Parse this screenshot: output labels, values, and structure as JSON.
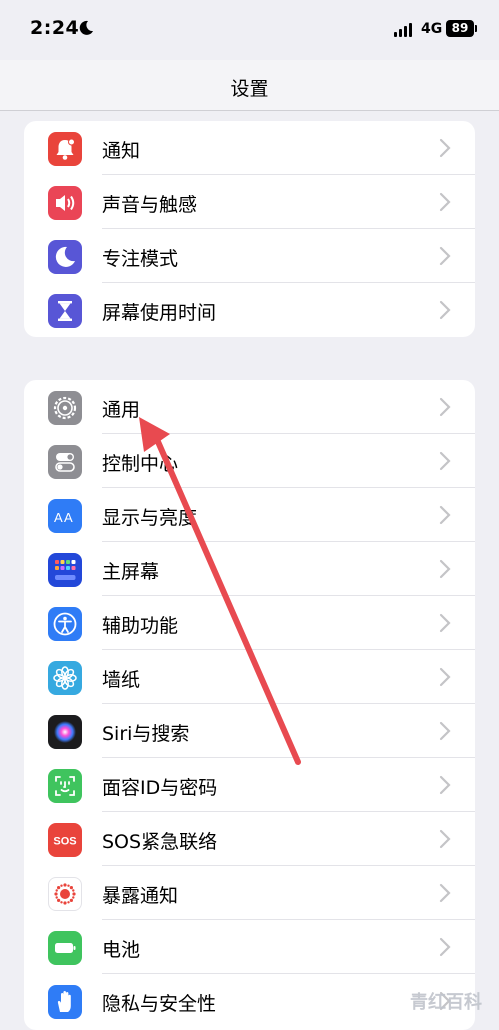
{
  "status_bar": {
    "time": "2:24",
    "network": "4G",
    "battery": "89"
  },
  "nav": {
    "title": "设置"
  },
  "group1": [
    {
      "label": "通知",
      "icon": "bell-icon",
      "color": "#e9443b"
    },
    {
      "label": "声音与触感",
      "icon": "speaker-icon",
      "color": "#ea4556"
    },
    {
      "label": "专注模式",
      "icon": "moon-icon",
      "color": "#5856d6"
    },
    {
      "label": "屏幕使用时间",
      "icon": "hourglass-icon",
      "color": "#5856d6"
    }
  ],
  "group2": [
    {
      "label": "通用",
      "icon": "gear-icon",
      "color": "#8e8e93"
    },
    {
      "label": "控制中心",
      "icon": "toggle-icon",
      "color": "#8e8e93"
    },
    {
      "label": "显示与亮度",
      "icon": "text-size-icon",
      "color": "#2f7cf6"
    },
    {
      "label": "主屏幕",
      "icon": "home-screen-icon",
      "color": "#2348d9"
    },
    {
      "label": "辅助功能",
      "icon": "accessibility-icon",
      "color": "#2f7cf6"
    },
    {
      "label": "墙纸",
      "icon": "flower-icon",
      "color": "#36a9e0"
    },
    {
      "label": "Siri与搜索",
      "icon": "siri-icon",
      "color": "#1c1c1e"
    },
    {
      "label": "面容ID与密码",
      "icon": "face-id-icon",
      "color": "#3fc45e"
    },
    {
      "label": "SOS紧急联络",
      "icon": "sos-icon",
      "color": "#e9443b"
    },
    {
      "label": "暴露通知",
      "icon": "exposure-icon",
      "color": "#ffffff"
    },
    {
      "label": "电池",
      "icon": "battery-icon",
      "color": "#3fc45e"
    },
    {
      "label": "隐私与安全性",
      "icon": "hand-icon",
      "color": "#2f7cf6"
    }
  ],
  "watermark": "青红百科",
  "annotation_color": "#e84a50"
}
